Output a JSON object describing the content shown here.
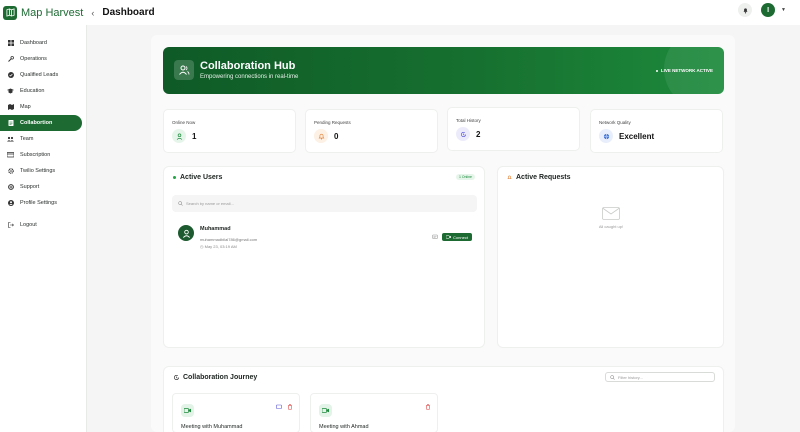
{
  "app": {
    "name": "Map Harvest",
    "page_title": "Dashboard",
    "avatar_initial": "I"
  },
  "sidebar": {
    "items": [
      {
        "label": "Dashboard",
        "icon": "dashboard-icon"
      },
      {
        "label": "Operations",
        "icon": "wrench-icon"
      },
      {
        "label": "Qualified Leads",
        "icon": "check-circle-icon"
      },
      {
        "label": "Education",
        "icon": "graduation-cap-icon"
      },
      {
        "label": "Map",
        "icon": "map-icon"
      },
      {
        "label": "Collabortion",
        "icon": "document-icon",
        "active": true
      },
      {
        "label": "Team",
        "icon": "team-icon"
      },
      {
        "label": "Subscription",
        "icon": "card-icon"
      },
      {
        "label": "Twilio Settings",
        "icon": "gear-icon"
      },
      {
        "label": "Support",
        "icon": "lifebuoy-icon"
      },
      {
        "label": "Profile Settings",
        "icon": "user-circle-icon"
      }
    ],
    "logout_label": "Logout"
  },
  "hero": {
    "title": "Collaboration Hub",
    "subtitle": "Empowering connections in real-time",
    "live_label": "LIVE NETWORK ACTIVE"
  },
  "stats": [
    {
      "label": "Online Now",
      "value": "1",
      "icon": "user-icon",
      "color": "#1d8a3c"
    },
    {
      "label": "Pending Requests",
      "value": "0",
      "icon": "bell-icon",
      "color": "#e07b2c"
    },
    {
      "label": "Total History",
      "value": "2",
      "icon": "history-icon",
      "color": "#5b56d6"
    },
    {
      "label": "Network Quality",
      "value": "Excellent",
      "icon": "globe-icon",
      "color": "#3b6fd6"
    }
  ],
  "active_users": {
    "title": "Active Users",
    "badge": "1 Online",
    "search_placeholder": "Search by name or email...",
    "users": [
      {
        "name": "Muhammad",
        "email": "muhammadbilal786@gmail.com",
        "time": "May 23, 03:19 AM",
        "connect_label": "Connect"
      }
    ]
  },
  "active_requests": {
    "title": "Active Requests",
    "empty_text": "All caught up!"
  },
  "journey": {
    "title": "Collaboration Journey",
    "filter_placeholder": "Filter history...",
    "meetings": [
      {
        "title": "Meeting with Muhammad"
      },
      {
        "title": "Meeting with Ahmad"
      }
    ]
  },
  "colors": {
    "primary": "#1d6b32",
    "accent": "#22a447",
    "danger": "#e04848"
  }
}
